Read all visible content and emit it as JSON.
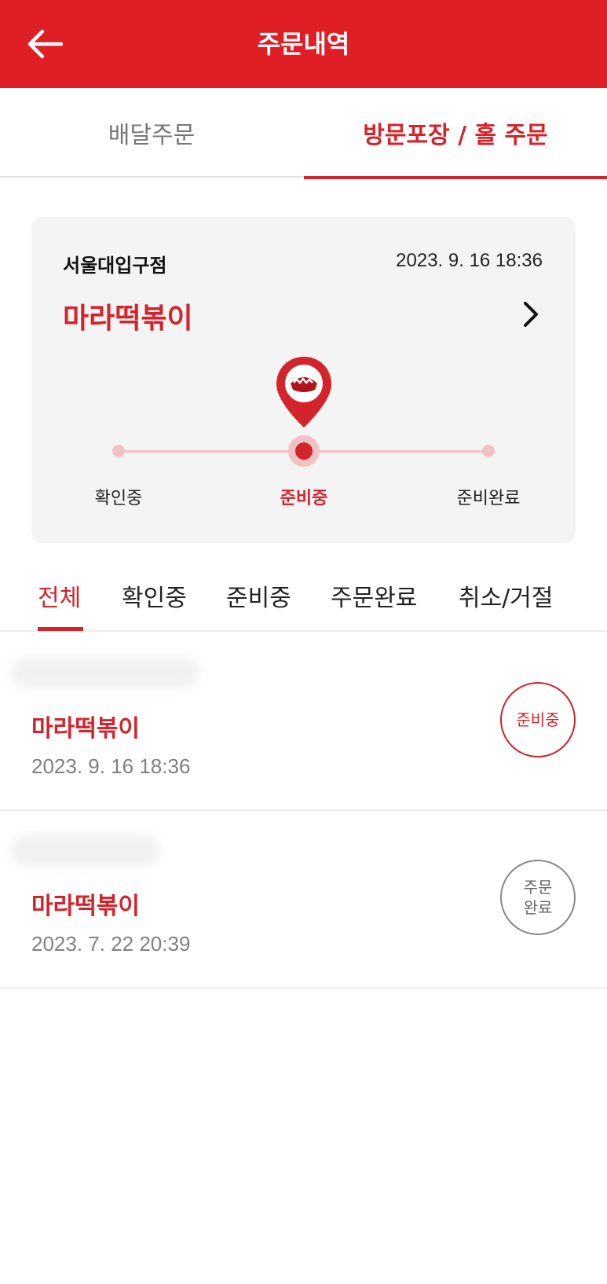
{
  "header": {
    "title": "주문내역",
    "back_icon": "arrow-left-icon"
  },
  "top_tabs": [
    {
      "label": "배달주문",
      "active": false
    },
    {
      "label": "방문포장 / 홀 주문",
      "active": true
    }
  ],
  "current_order": {
    "store": "서울대입구점",
    "datetime": "2023. 9. 16 18:36",
    "menu": "마라떡볶이",
    "steps": [
      "확인중",
      "준비중",
      "준비완료"
    ],
    "current_step": 1
  },
  "filter_tabs": [
    "전체",
    "확인중",
    "준비중",
    "주문완료",
    "취소/거절"
  ],
  "orders": [
    {
      "menu": "마라떡볶이",
      "date": "2023. 9. 16 18:36",
      "status": "준비중"
    },
    {
      "menu": "마라떡볶이",
      "date": "2023. 7. 22 20:39",
      "status_line1": "주문",
      "status_line2": "완료"
    }
  ],
  "colors": {
    "brand_red": "#e01e26",
    "accent_red": "#d3232b"
  }
}
